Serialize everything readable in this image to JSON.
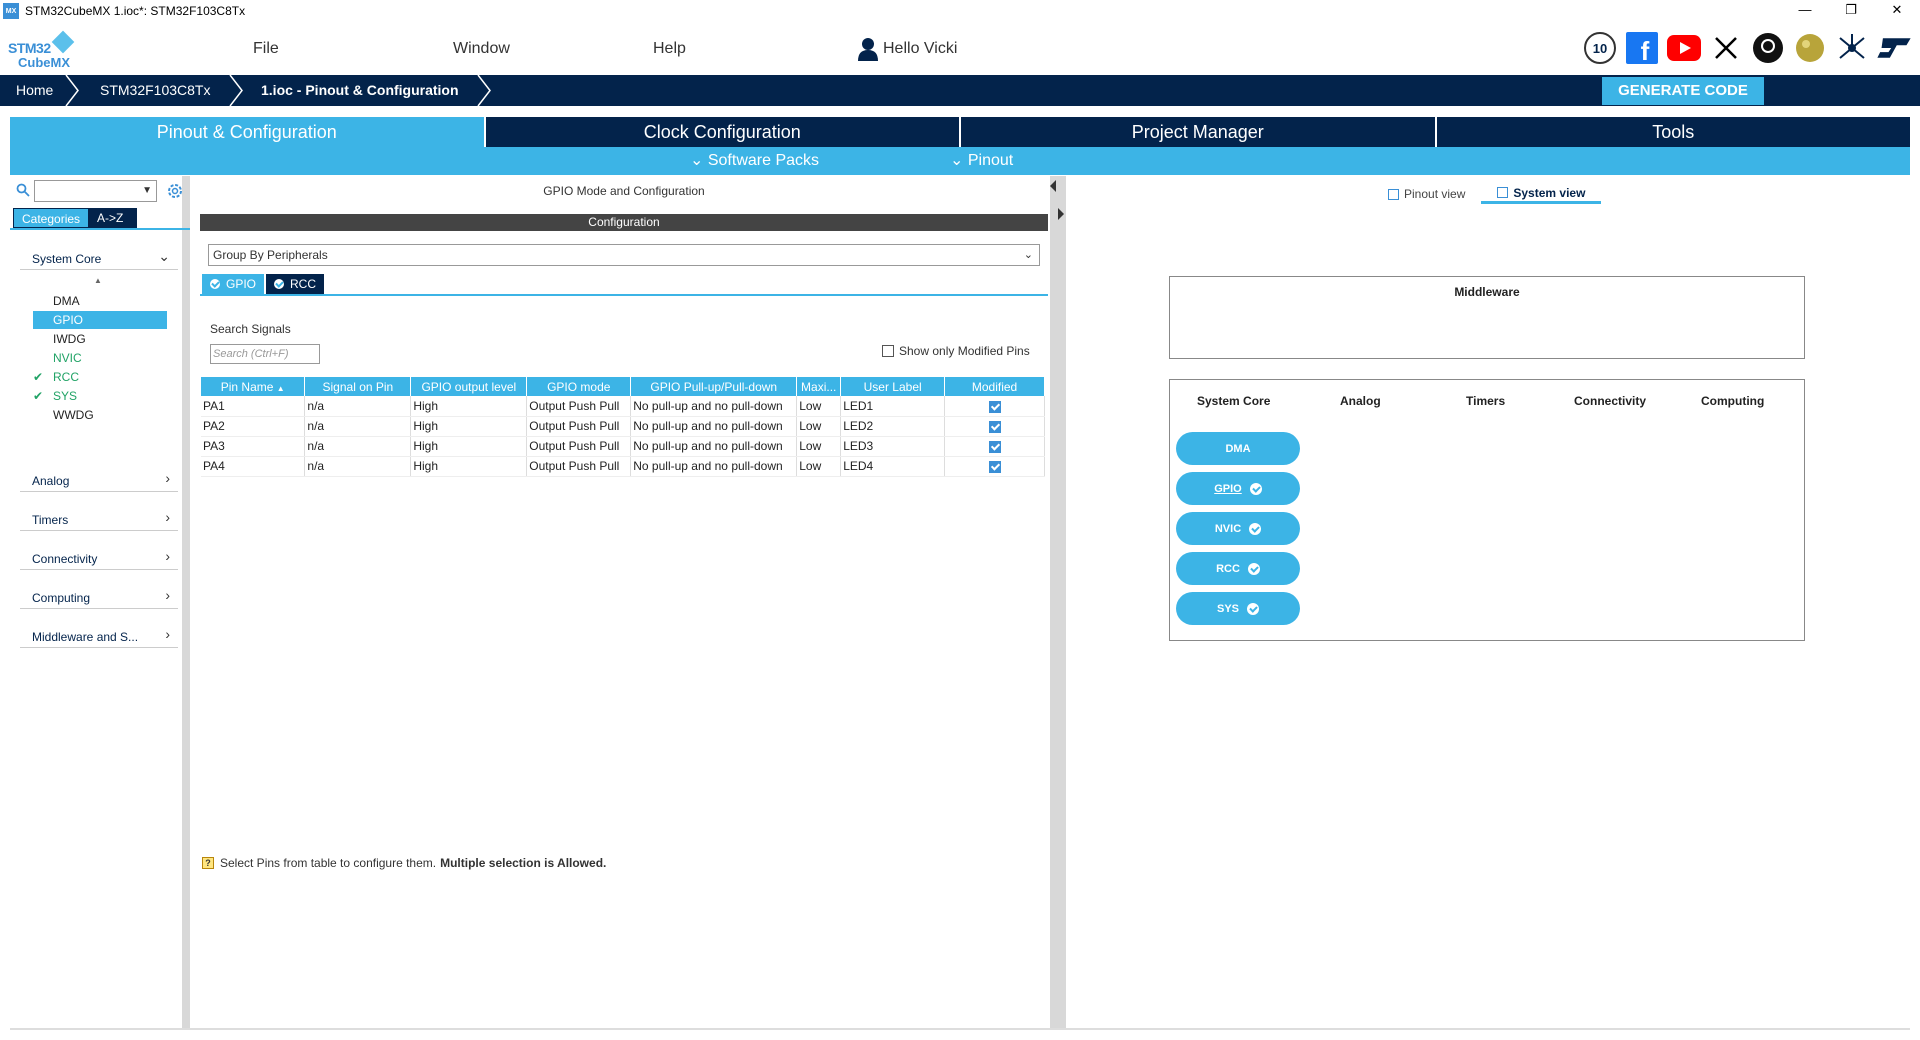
{
  "window": {
    "title": "STM32CubeMX 1.ioc*: STM32F103C8Tx",
    "app_icon": "MX",
    "controls": [
      "—",
      "❐",
      "✕"
    ]
  },
  "header": {
    "logo_line1": "STM32",
    "logo_line2": "CubeMX",
    "menu": [
      "File",
      "Window",
      "Help"
    ],
    "user_greeting": "Hello Vicki",
    "social_icons": [
      "anniversary-10-icon",
      "facebook-icon",
      "youtube-icon",
      "x-icon",
      "github-icon",
      "community-icon",
      "network-icon",
      "st-logo-icon"
    ]
  },
  "breadcrumb": {
    "items": [
      "Home",
      "STM32F103C8Tx",
      "1.ioc - Pinout & Configuration"
    ]
  },
  "generate_button": "GENERATE CODE",
  "tabs": [
    "Pinout & Configuration",
    "Clock Configuration",
    "Project Manager",
    "Tools"
  ],
  "subbar": {
    "software_packs": "Software Packs",
    "pinout": "Pinout"
  },
  "sidebar": {
    "search_value": "",
    "category_tabs": [
      "Categories",
      "A->Z"
    ],
    "categories": [
      "System Core",
      "Analog",
      "Timers",
      "Connectivity",
      "Computing",
      "Middleware and S..."
    ],
    "system_core_items": [
      {
        "name": "DMA",
        "checked": false,
        "selected": false
      },
      {
        "name": "GPIO",
        "checked": false,
        "selected": true
      },
      {
        "name": "IWDG",
        "checked": false,
        "selected": false
      },
      {
        "name": "NVIC",
        "checked": false,
        "selected": false
      },
      {
        "name": "RCC",
        "checked": true,
        "selected": false
      },
      {
        "name": "SYS",
        "checked": true,
        "selected": false
      },
      {
        "name": "WWDG",
        "checked": false,
        "selected": false
      }
    ]
  },
  "middle": {
    "title": "GPIO Mode and Configuration",
    "config_header": "Configuration",
    "group_by": "Group By Peripherals",
    "subtabs": [
      "GPIO",
      "RCC"
    ],
    "search_label": "Search Signals",
    "search_placeholder": "Search (Ctrl+F)",
    "show_modified": "Show only Modified Pins",
    "table": {
      "headers": [
        "Pin Name",
        "Signal on Pin",
        "GPIO output level",
        "GPIO mode",
        "GPIO Pull-up/Pull-down",
        "Maxi...",
        "User Label",
        "Modified"
      ],
      "rows": [
        [
          "PA1",
          "n/a",
          "High",
          "Output Push Pull",
          "No pull-up and no pull-down",
          "Low",
          "LED1",
          true
        ],
        [
          "PA2",
          "n/a",
          "High",
          "Output Push Pull",
          "No pull-up and no pull-down",
          "Low",
          "LED2",
          true
        ],
        [
          "PA3",
          "n/a",
          "High",
          "Output Push Pull",
          "No pull-up and no pull-down",
          "Low",
          "LED3",
          true
        ],
        [
          "PA4",
          "n/a",
          "High",
          "Output Push Pull",
          "No pull-up and no pull-down",
          "Low",
          "LED4",
          true
        ]
      ]
    },
    "hint_text": "Select Pins from table to configure them.",
    "hint_bold": "Multiple selection is Allowed."
  },
  "right": {
    "view_tabs": [
      "Pinout view",
      "System view"
    ],
    "middleware_title": "Middleware",
    "columns": [
      "System Core",
      "Analog",
      "Timers",
      "Connectivity",
      "Computing"
    ],
    "system_core_pills": [
      {
        "label": "DMA",
        "check": false
      },
      {
        "label": "GPIO",
        "check": true
      },
      {
        "label": "NVIC",
        "check": true
      },
      {
        "label": "RCC",
        "check": true
      },
      {
        "label": "SYS",
        "check": true
      }
    ]
  },
  "colors": {
    "navy": "#03234b",
    "accent": "#3cb4e6",
    "green": "#21a366"
  }
}
